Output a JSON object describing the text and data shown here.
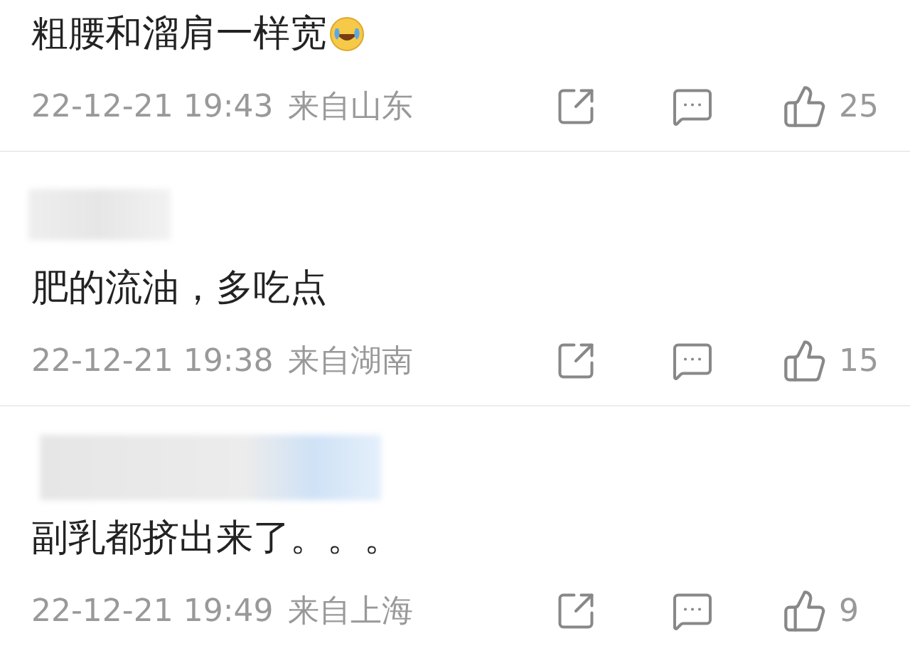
{
  "comments": [
    {
      "redacted_name": false,
      "text": "粗腰和溜肩一样宽",
      "emoji": true,
      "time": "22-12-21 19:43",
      "location": "来自山东",
      "likes": "25"
    },
    {
      "redacted_name": true,
      "text": "肥的流油，多吃点",
      "emoji": false,
      "time": "22-12-21 19:38",
      "location": "来自湖南",
      "likes": "15"
    },
    {
      "redacted_name": true,
      "text": "副乳都挤出来了。。。",
      "emoji": false,
      "time": "22-12-21 19:49",
      "location": "来自上海",
      "likes": "9"
    }
  ]
}
